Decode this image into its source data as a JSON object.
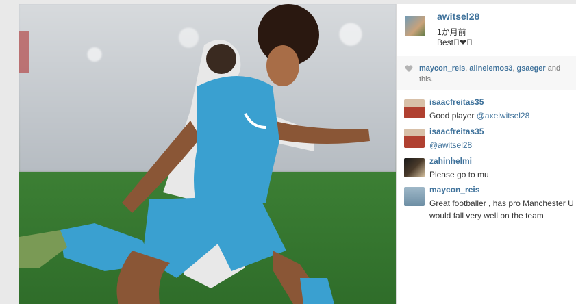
{
  "post": {
    "owner": "awitsel28",
    "time": "1か月前",
    "caption": "Best󾓦❤󾓦"
  },
  "likes": {
    "users": [
      "maycon_reis",
      "alinelemos3",
      "gsaeger"
    ],
    "sep1": ", ",
    "sep2": ", ",
    "suffix": " and",
    "tail": "this."
  },
  "comments": [
    {
      "user": "isaacfreitas35",
      "text": "Good player ",
      "mention": "@axelwitsel28"
    },
    {
      "user": "isaacfreitas35",
      "text": "",
      "mention": "@awitsel28"
    },
    {
      "user": "zahinhelmi",
      "text": "Please go to mu",
      "mention": ""
    },
    {
      "user": "maycon_reis",
      "text": "Great footballer , has pro Manchester U would fall very well on the team",
      "mention": ""
    }
  ],
  "colors": {
    "link": "#3f729b",
    "jersey": "#3aa0d0"
  },
  "icons": {
    "like": "heart-icon"
  }
}
